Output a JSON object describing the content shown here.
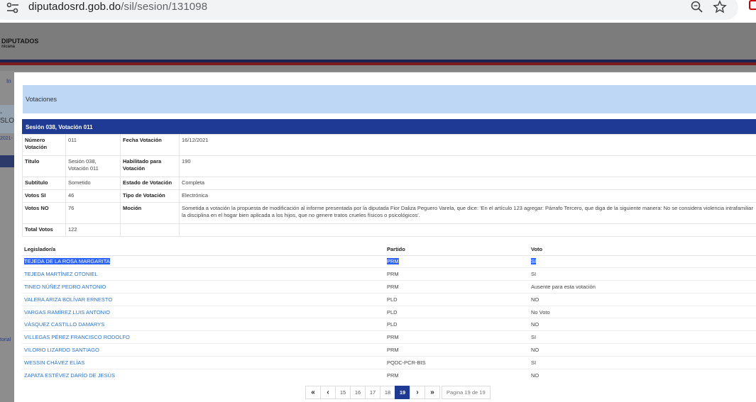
{
  "browser": {
    "url_host": "diputadosrd.gob.do",
    "url_path": "/sil/sesion/131098"
  },
  "background": {
    "brand": "DIPUTADOS",
    "brand_sub": "nicana",
    "side_texts": [
      "In",
      "-SLO",
      "2021-",
      "torial"
    ]
  },
  "modal": {
    "header": "Votaciones",
    "panel_title": "Sesión 038, Votación 011",
    "info": {
      "numero_label": "Número Votación",
      "numero": "011",
      "fecha_label": "Fecha Votación",
      "fecha": "16/12/2021",
      "titulo_label": "Titulo",
      "titulo": "Sesión 038, Votación 011",
      "habilitado_label": "Habilitado para Votación",
      "habilitado": "190",
      "subtitulo_label": "Subtitulo",
      "subtitulo": "Sometido",
      "estado_label": "Estado de Votación",
      "estado": "Completa",
      "si_label": "Votos SI",
      "si": "46",
      "tipo_label": "Tipo de Votación",
      "tipo": "Electrónica",
      "no_label": "Votos NO",
      "no": "76",
      "mocion_label": "Moción",
      "mocion": "Sometida a votación la propuesta de modificación al informe presentada por la diputada Fior Daliza Peguero Varela, que dice: 'En el artículo 123 agregar: Párrafo Tercero, que diga de la siguiente manera: No se considera violencia intrafamiliar la disciplina en el hogar bien aplicada a los hijos, que no genere tratos crueles físicos o psicológicos'.",
      "total_label": "Total Votos",
      "total": "122"
    },
    "columns": {
      "legislador": "Legislador/a",
      "partido": "Partido",
      "voto": "Voto"
    },
    "rows": [
      {
        "name": "TEJEDA DE LA ROSA MARGARITA",
        "party": "PRM",
        "vote": "SI"
      },
      {
        "name": "TEJEDA MARTÍNEZ OTONIEL",
        "party": "PRM",
        "vote": "SI"
      },
      {
        "name": "TINEO NÚÑEZ PEDRO ANTONIO",
        "party": "PRM",
        "vote": "Ausente para esta votación"
      },
      {
        "name": "VALERA ARIZA BOLÍVAR ERNESTO",
        "party": "PLD",
        "vote": "NO"
      },
      {
        "name": "VARGAS RAMÍREZ LUIS ANTONIO",
        "party": "PLD",
        "vote": "No Voto"
      },
      {
        "name": "VÁSQUEZ CASTILLO DAMARYS",
        "party": "PLD",
        "vote": "NO"
      },
      {
        "name": "VILLEGAS PÉREZ FRANCISCO RODOLFO",
        "party": "PRM",
        "vote": "SI"
      },
      {
        "name": "VILORIO LIZARDO SANTIAGO",
        "party": "PRM",
        "vote": "NO"
      },
      {
        "name": "WESSIN CHÁVEZ ELÍAS",
        "party": "PQDC-PCR-BIS",
        "vote": "SI"
      },
      {
        "name": "ZAPATA ESTÉVEZ DARÍO DE JESÚS",
        "party": "PRM",
        "vote": "NO"
      }
    ],
    "pager": {
      "first": "«",
      "prev": "‹",
      "pages": [
        "15",
        "16",
        "17",
        "18",
        "19"
      ],
      "current": "19",
      "next": "›",
      "last": "»",
      "info": "Pagina 19 de 19"
    }
  }
}
